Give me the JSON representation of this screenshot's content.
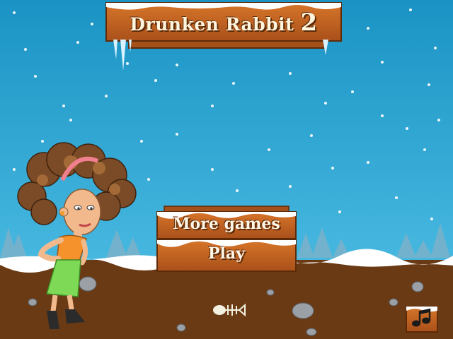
{
  "game": {
    "title": "Drunken Rabbit",
    "title_number": "2"
  },
  "menu": {
    "more_games_label": "More games",
    "play_label": "Play"
  },
  "icons": {
    "music": "music-note-icon"
  },
  "colors": {
    "sky_top": "#1f9ac9",
    "sky_bottom": "#4cc0e6",
    "ground": "#6a3a14",
    "wood": "#c9671d",
    "snow": "#ffffff"
  }
}
